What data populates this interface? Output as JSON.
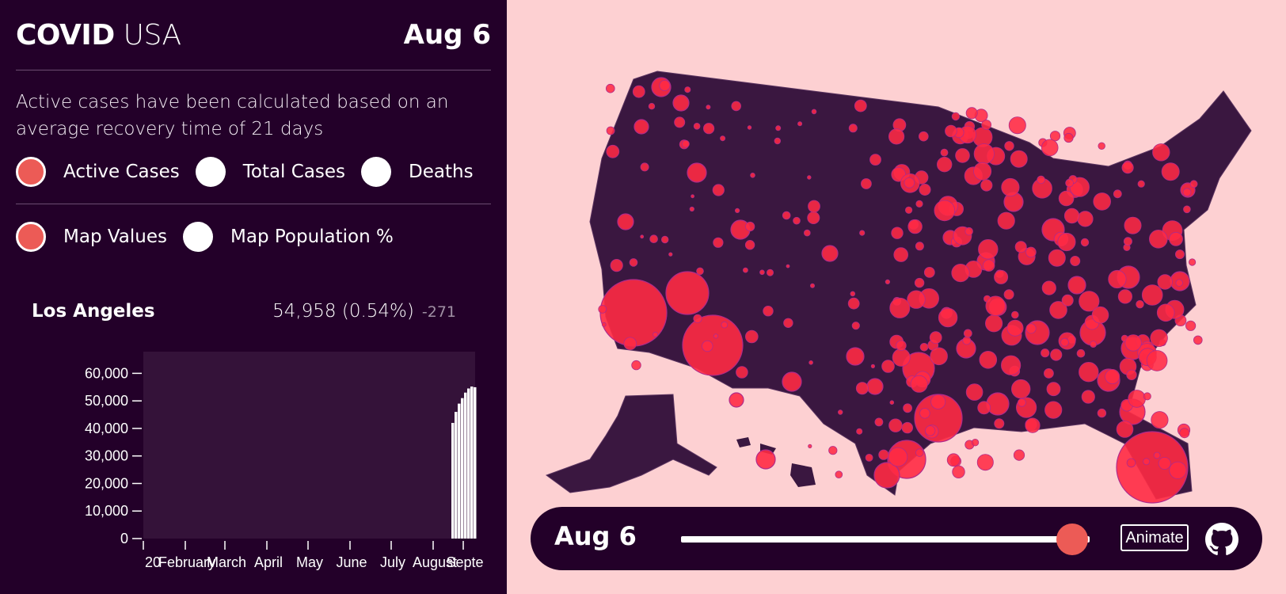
{
  "header": {
    "title_bold": "COVID",
    "title_light": "USA",
    "date": "Aug 6"
  },
  "description": "Active cases have been calculated based on an average recovery time of 21 days",
  "metric_options": [
    {
      "label": "Active Cases",
      "selected": true
    },
    {
      "label": "Total Cases",
      "selected": false
    },
    {
      "label": "Deaths",
      "selected": false
    }
  ],
  "map_mode_options": [
    {
      "label": "Map Values",
      "selected": true
    },
    {
      "label": "Map Population %",
      "selected": false
    }
  ],
  "location": {
    "name": "Los Angeles",
    "value": "54,958 (0.54%)",
    "delta": "-271"
  },
  "chart_data": {
    "type": "bar",
    "title": "",
    "xlabel": "",
    "ylabel": "",
    "ylim": [
      0,
      65000
    ],
    "yticks": [
      "60,000",
      "50,000",
      "40,000",
      "30,000",
      "20,000",
      "10,000",
      "0"
    ],
    "xticks": [
      "20",
      "February",
      "March",
      "April",
      "May",
      "June",
      "July",
      "August",
      "Septe"
    ],
    "series": [
      {
        "values": [
          42000,
          46000,
          49000,
          51000,
          53000,
          54500,
          55200,
          54958
        ]
      }
    ]
  },
  "timeline": {
    "date": "Aug 6",
    "position": 0.92,
    "animate_label": "Animate"
  },
  "colors": {
    "panel": "#230029",
    "accent": "#ec5b56",
    "map_bg": "#fdd0d2",
    "bubble": "#ff2a44"
  },
  "icons": {
    "repo": "github-icon"
  }
}
